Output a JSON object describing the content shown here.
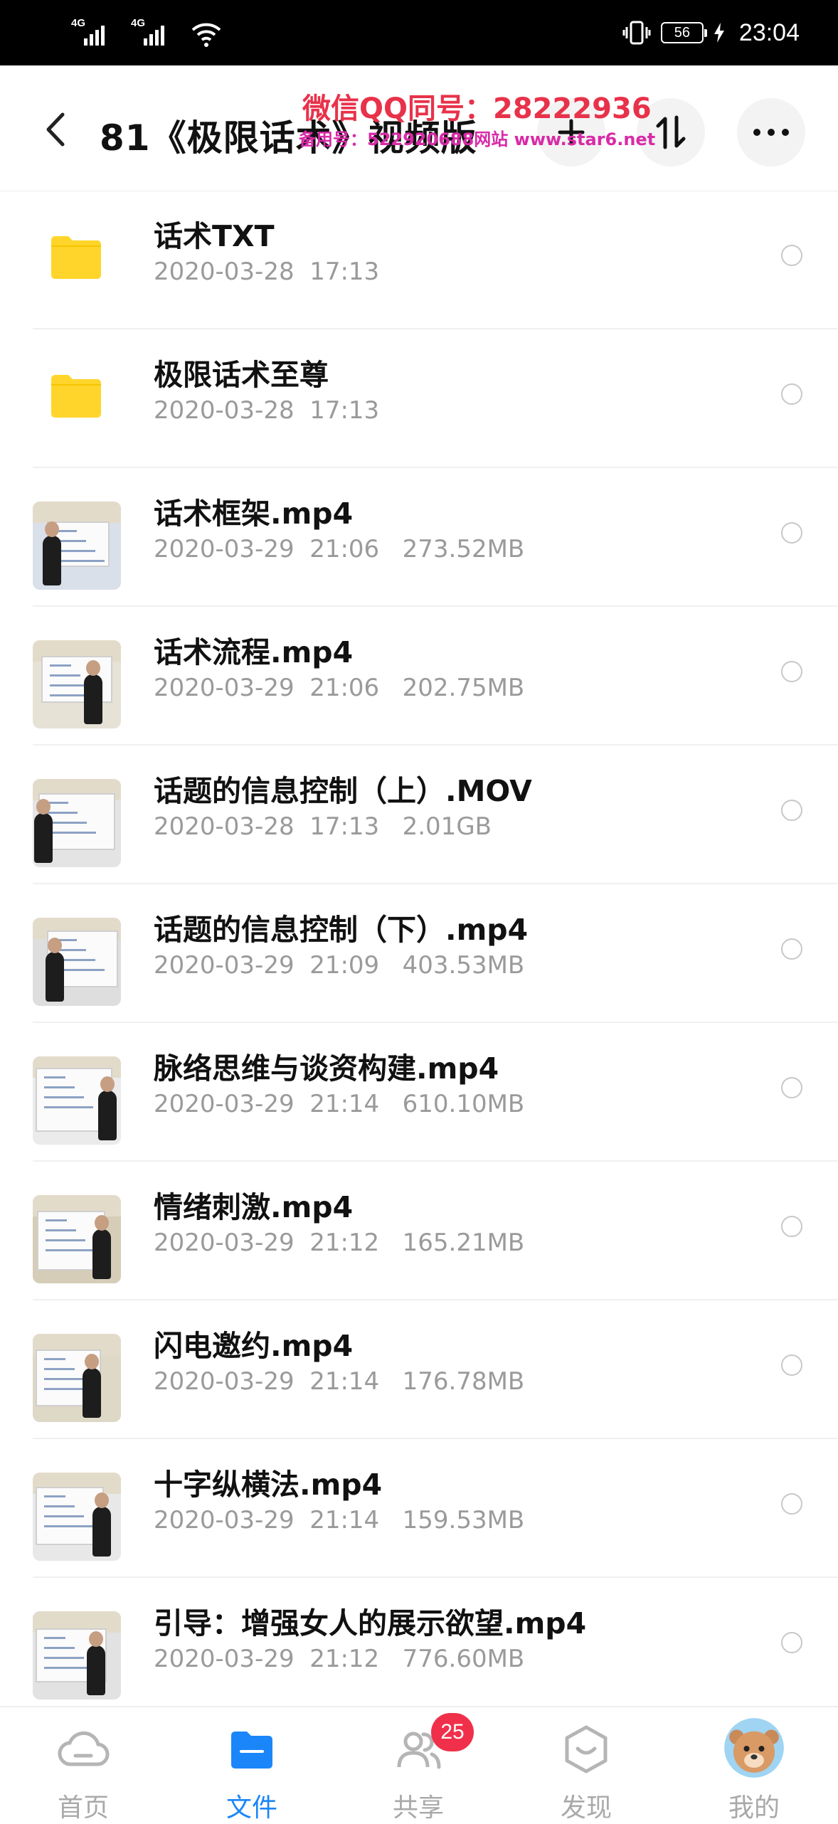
{
  "status_bar": {
    "signal1": "4G",
    "signal2": "4G",
    "battery": "56",
    "time": "23:04"
  },
  "header": {
    "title": "81《极限话术》视频版",
    "watermark_line1": "微信QQ同号：28222936",
    "watermark_line2": "备用号：522920688网站 www.star6.net"
  },
  "files": [
    {
      "name": "话术TXT",
      "meta": "2020-03-28  17:13",
      "kind": "folder"
    },
    {
      "name": "极限话术至尊",
      "meta": "2020-03-28  17:13",
      "kind": "folder"
    },
    {
      "name": "话术框架.mp4",
      "meta": "2020-03-29  21:06   273.52MB",
      "kind": "video"
    },
    {
      "name": "话术流程.mp4",
      "meta": "2020-03-29  21:06   202.75MB",
      "kind": "video"
    },
    {
      "name": "话题的信息控制（上）.MOV",
      "meta": "2020-03-28  17:13   2.01GB",
      "kind": "video"
    },
    {
      "name": "话题的信息控制（下）.mp4",
      "meta": "2020-03-29  21:09   403.53MB",
      "kind": "video"
    },
    {
      "name": "脉络思维与谈资构建.mp4",
      "meta": "2020-03-29  21:14   610.10MB",
      "kind": "video"
    },
    {
      "name": "情绪刺激.mp4",
      "meta": "2020-03-29  21:12   165.21MB",
      "kind": "video"
    },
    {
      "name": "闪电邀约.mp4",
      "meta": "2020-03-29  21:14   176.78MB",
      "kind": "video"
    },
    {
      "name": "十字纵横法.mp4",
      "meta": "2020-03-29  21:14   159.53MB",
      "kind": "video"
    },
    {
      "name": "引导：增强女人的展示欲望.mp4",
      "meta": "2020-03-29  21:12   776.60MB",
      "kind": "video"
    }
  ],
  "bottom_nav": {
    "home": "首页",
    "files": "文件",
    "share": "共享",
    "share_badge": "25",
    "discover": "发现",
    "mine": "我的"
  },
  "colors": {
    "accent": "#1b86f9",
    "folder": "#ffd52b",
    "badge": "#f0304a",
    "watermark_red": "#e8324a",
    "watermark_magenta": "#d92aa8"
  }
}
